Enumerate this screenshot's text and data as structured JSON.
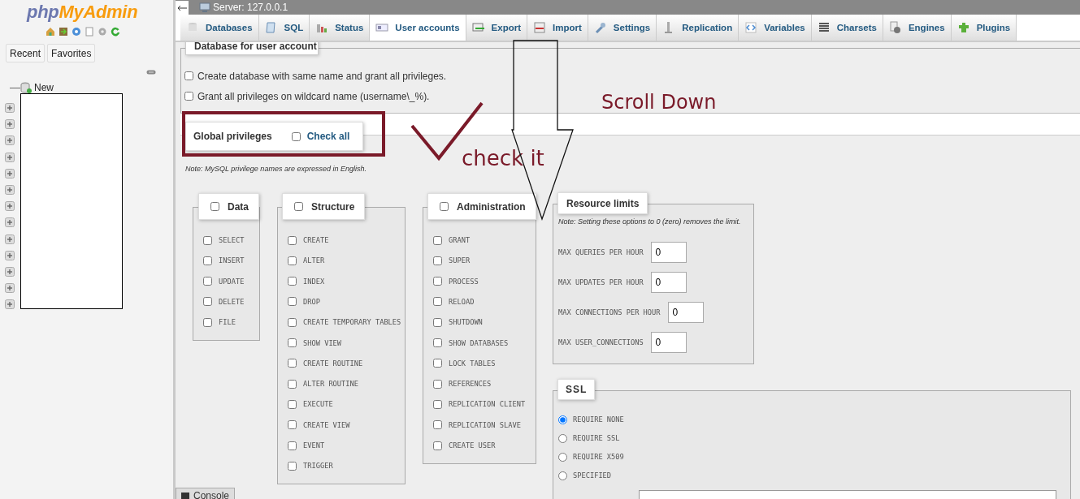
{
  "sidebar": {
    "logo": {
      "part_1": "php",
      "part_2": "MyAdmin"
    },
    "buttons": [
      {
        "label": "Recent"
      },
      {
        "label": "Favorites"
      }
    ],
    "tree": {
      "new_label": "New",
      "databases": [
        {
          "expanded": false
        },
        {
          "expanded": false
        },
        {
          "expanded": false
        },
        {
          "expanded": false
        },
        {
          "expanded": false
        },
        {
          "expanded": false
        },
        {
          "expanded": false
        },
        {
          "expanded": false
        },
        {
          "expanded": false
        },
        {
          "expanded": false
        },
        {
          "expanded": false
        },
        {
          "expanded": false
        },
        {
          "expanded": false
        }
      ]
    }
  },
  "breadcrumb": "Server: 127.0.0.1",
  "tabs": [
    {
      "label": "Databases",
      "selected": false
    },
    {
      "label": "SQL",
      "selected": false
    },
    {
      "label": "Status",
      "selected": false
    },
    {
      "label": "User accounts",
      "selected": true
    },
    {
      "label": "Export",
      "selected": false
    },
    {
      "label": "Import",
      "selected": false
    },
    {
      "label": "Settings",
      "selected": false
    },
    {
      "label": "Replication",
      "selected": false
    },
    {
      "label": "Variables",
      "selected": false
    },
    {
      "label": "Charsets",
      "selected": false
    },
    {
      "label": "Engines",
      "selected": false
    },
    {
      "label": "Plugins",
      "selected": false
    }
  ],
  "database_section": {
    "legend": "Database for user account",
    "options": [
      {
        "label": "Create database with same name and grant all privileges.",
        "checked": false
      },
      {
        "label": "Grant all privileges on wildcard name (username\\_%).",
        "checked": false
      }
    ]
  },
  "global_privileges": {
    "legend": "Global privileges",
    "check_all": {
      "label": "Check all",
      "checked": false
    },
    "note": "Note: MySQL privilege names are expressed in English.",
    "groups": [
      {
        "title": "Data",
        "checked": false,
        "items": [
          {
            "label": "SELECT",
            "checked": false
          },
          {
            "label": "INSERT",
            "checked": false
          },
          {
            "label": "UPDATE",
            "checked": false
          },
          {
            "label": "DELETE",
            "checked": false
          },
          {
            "label": "FILE",
            "checked": false
          }
        ]
      },
      {
        "title": "Structure",
        "checked": false,
        "items": [
          {
            "label": "CREATE",
            "checked": false
          },
          {
            "label": "ALTER",
            "checked": false
          },
          {
            "label": "INDEX",
            "checked": false
          },
          {
            "label": "DROP",
            "checked": false
          },
          {
            "label": "CREATE TEMPORARY TABLES",
            "checked": false
          },
          {
            "label": "SHOW VIEW",
            "checked": false
          },
          {
            "label": "CREATE ROUTINE",
            "checked": false
          },
          {
            "label": "ALTER ROUTINE",
            "checked": false
          },
          {
            "label": "EXECUTE",
            "checked": false
          },
          {
            "label": "CREATE VIEW",
            "checked": false
          },
          {
            "label": "EVENT",
            "checked": false
          },
          {
            "label": "TRIGGER",
            "checked": false
          }
        ]
      },
      {
        "title": "Administration",
        "checked": false,
        "items": [
          {
            "label": "GRANT",
            "checked": false
          },
          {
            "label": "SUPER",
            "checked": false
          },
          {
            "label": "PROCESS",
            "checked": false
          },
          {
            "label": "RELOAD",
            "checked": false
          },
          {
            "label": "SHUTDOWN",
            "checked": false
          },
          {
            "label": "SHOW DATABASES",
            "checked": false
          },
          {
            "label": "LOCK TABLES",
            "checked": false
          },
          {
            "label": "REFERENCES",
            "checked": false
          },
          {
            "label": "REPLICATION CLIENT",
            "checked": false
          },
          {
            "label": "REPLICATION SLAVE",
            "checked": false
          },
          {
            "label": "CREATE USER",
            "checked": false
          }
        ]
      }
    ]
  },
  "resource_limits": {
    "legend": "Resource limits",
    "note": "Note: Setting these options to 0 (zero) removes the limit.",
    "fields": [
      {
        "label": "MAX QUERIES PER HOUR",
        "value": "0"
      },
      {
        "label": "MAX UPDATES PER HOUR",
        "value": "0"
      },
      {
        "label": "MAX CONNECTIONS PER HOUR",
        "value": "0"
      },
      {
        "label": "MAX USER_CONNECTIONS",
        "value": "0"
      }
    ]
  },
  "ssl": {
    "legend": "SSL",
    "options": [
      {
        "label": "REQUIRE NONE",
        "selected": true
      },
      {
        "label": "REQUIRE SSL",
        "selected": false
      },
      {
        "label": "REQUIRE X509",
        "selected": false
      },
      {
        "label": "SPECIFIED",
        "selected": false
      }
    ]
  },
  "console": "Console",
  "annotations": [
    {
      "kind": "box"
    },
    {
      "kind": "check"
    },
    {
      "kind": "text",
      "text": "check it"
    },
    {
      "kind": "arrow"
    },
    {
      "kind": "text",
      "text": "Scroll Down"
    }
  ]
}
